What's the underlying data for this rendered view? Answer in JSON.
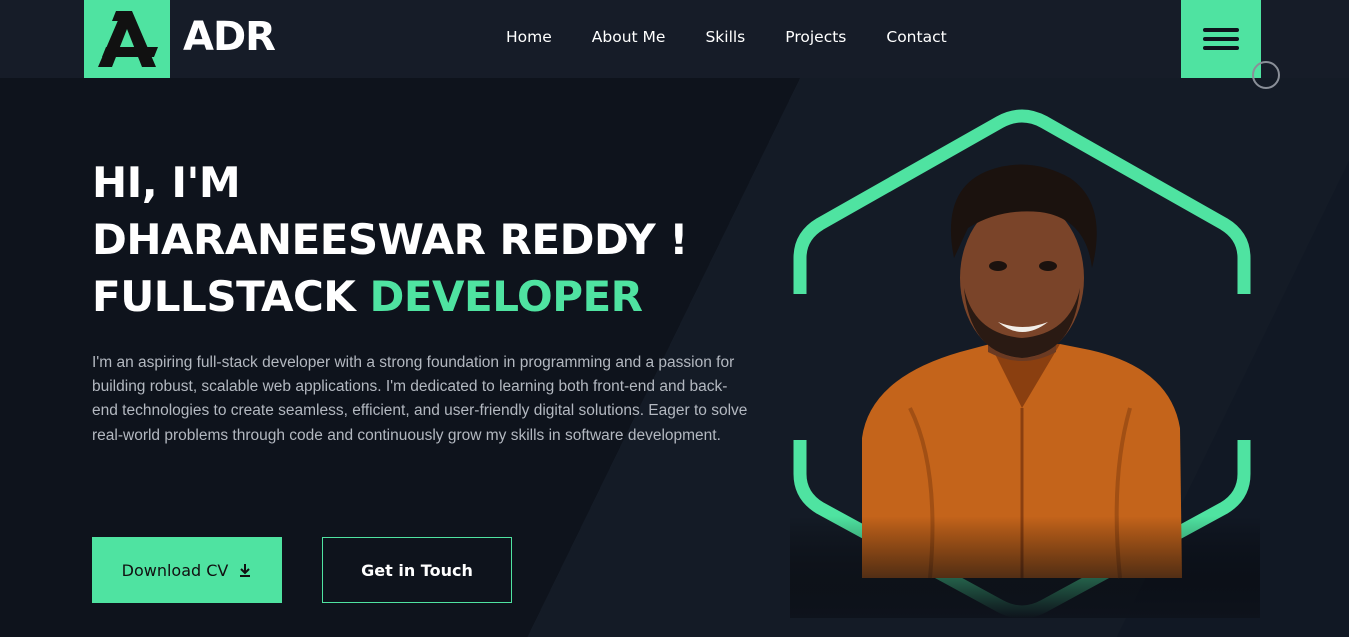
{
  "header": {
    "logo_text": "ADR",
    "nav": [
      "Home",
      "About Me",
      "Skills",
      "Projects",
      "Contact"
    ]
  },
  "hero": {
    "line1": "HI, I'M",
    "line2": "DHARANEESWAR REDDY !",
    "line3_prefix": "FULLSTACK",
    "line3_accent": "DEVELOPER",
    "description": "I'm an aspiring full-stack developer with a strong foundation in programming and a passion for building robust, scalable web applications. I'm dedicated to learning both front-end and back-end technologies to create seamless, efficient, and user-friendly digital solutions. Eager to solve real-world problems through code and continuously grow my skills in software development.",
    "btn_download": "Download CV",
    "btn_contact": "Get in Touch"
  },
  "icons": {
    "download": "download-icon",
    "menu": "hamburger-menu-icon"
  },
  "colors": {
    "accent": "#4fe3a1",
    "background": "#0e131c",
    "header": "#161c28"
  }
}
